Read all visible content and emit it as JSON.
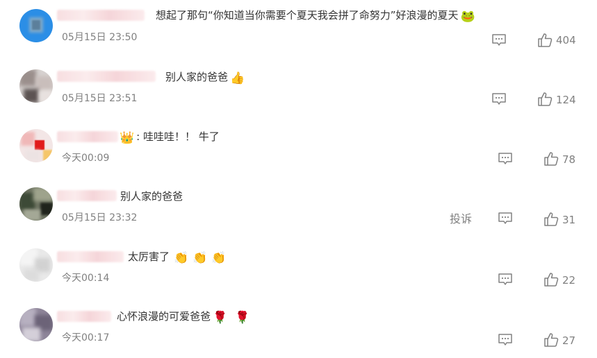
{
  "comments": [
    {
      "text": "想起了那句“你知道当你需要个夏天我会拼了命努力”好浪漫的夏天",
      "emoji_after": "frog-emoji",
      "time": "05月15日 23:50",
      "likes": "404"
    },
    {
      "text": "别人家的爸爸",
      "emoji_after": "thumbs-up-emoji",
      "time": "05月15日 23:51",
      "likes": "124"
    },
    {
      "prefix_emoji": "crown-emoji",
      "text": ": 哇哇哇！！ 牛了",
      "time": "今天00:09",
      "likes": "78"
    },
    {
      "text": "别人家的爸爸",
      "time": "05月15日 23:32",
      "report_label": "投诉",
      "likes": "31"
    },
    {
      "text": "太厉害了",
      "emoji_after": "clap-emoji",
      "time": "今天00:14",
      "likes": "22"
    },
    {
      "text": "心怀浪漫的可爱爸爸",
      "emoji_after": "rose-emoji",
      "time": "今天00:17",
      "likes": "27"
    }
  ],
  "colors": {
    "text": "#333333",
    "meta": "#808080",
    "avatar_blue": "#2b8ee6"
  },
  "icons": {
    "reply": "reply-icon",
    "like": "thumbs-up-outline-icon"
  }
}
